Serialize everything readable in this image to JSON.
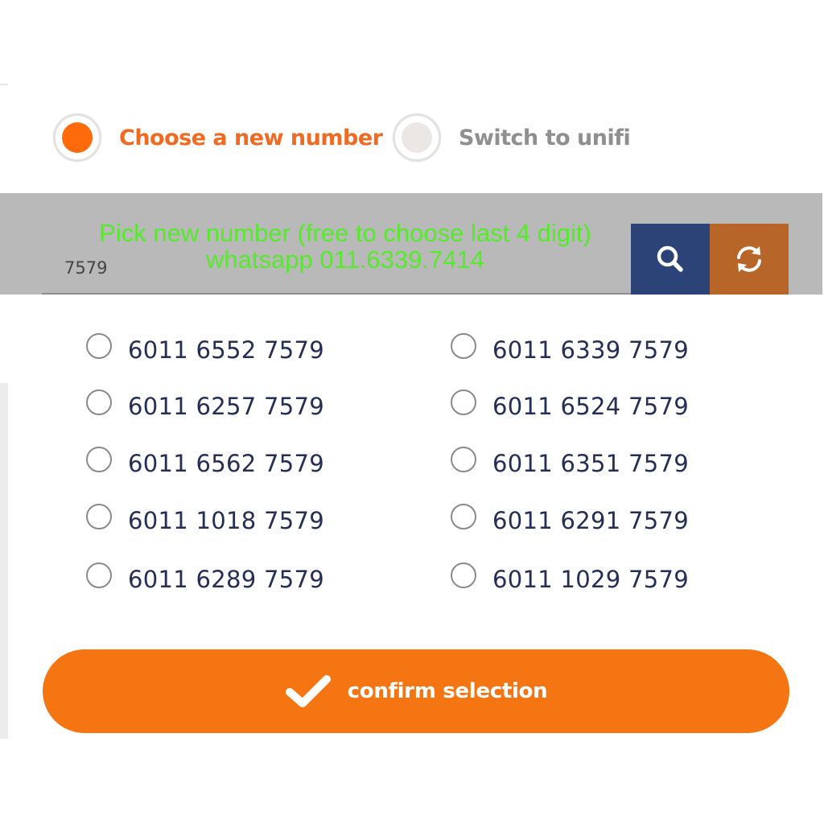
{
  "colors": {
    "accent": "#ff6a0c",
    "label_selected": "#f06a21",
    "label_unselected": "#8f8f8f",
    "search_button": "#2b4377",
    "refresh_button": "#b76529",
    "confirm_button": "#f47512",
    "promo_text": "#55ea2a",
    "number_text": "#252f56"
  },
  "choices": {
    "new_number": {
      "label": "Choose a new number",
      "selected": true,
      "icon": "radio-selected-icon"
    },
    "switch_unifi": {
      "label": "Switch to unifi",
      "selected": false,
      "icon": "radio-unselected-icon"
    }
  },
  "search": {
    "value": "7579",
    "search_icon": "search-icon",
    "refresh_icon": "refresh-icon"
  },
  "promo": {
    "line1": "Pick new number (free to choose last 4 digit)",
    "line2": "whatsapp  011.6339.7414"
  },
  "numbers": {
    "left": [
      "6011 6552 7579",
      "6011 6257 7579",
      "6011 6562 7579",
      "6011 1018 7579",
      "6011 6289 7579"
    ],
    "right": [
      "6011 6339 7579",
      "6011 6524 7579",
      "6011 6351 7579",
      "6011 6291 7579",
      "6011 1029 7579"
    ]
  },
  "confirm": {
    "label": "confirm selection",
    "icon": "checkmark-icon"
  }
}
